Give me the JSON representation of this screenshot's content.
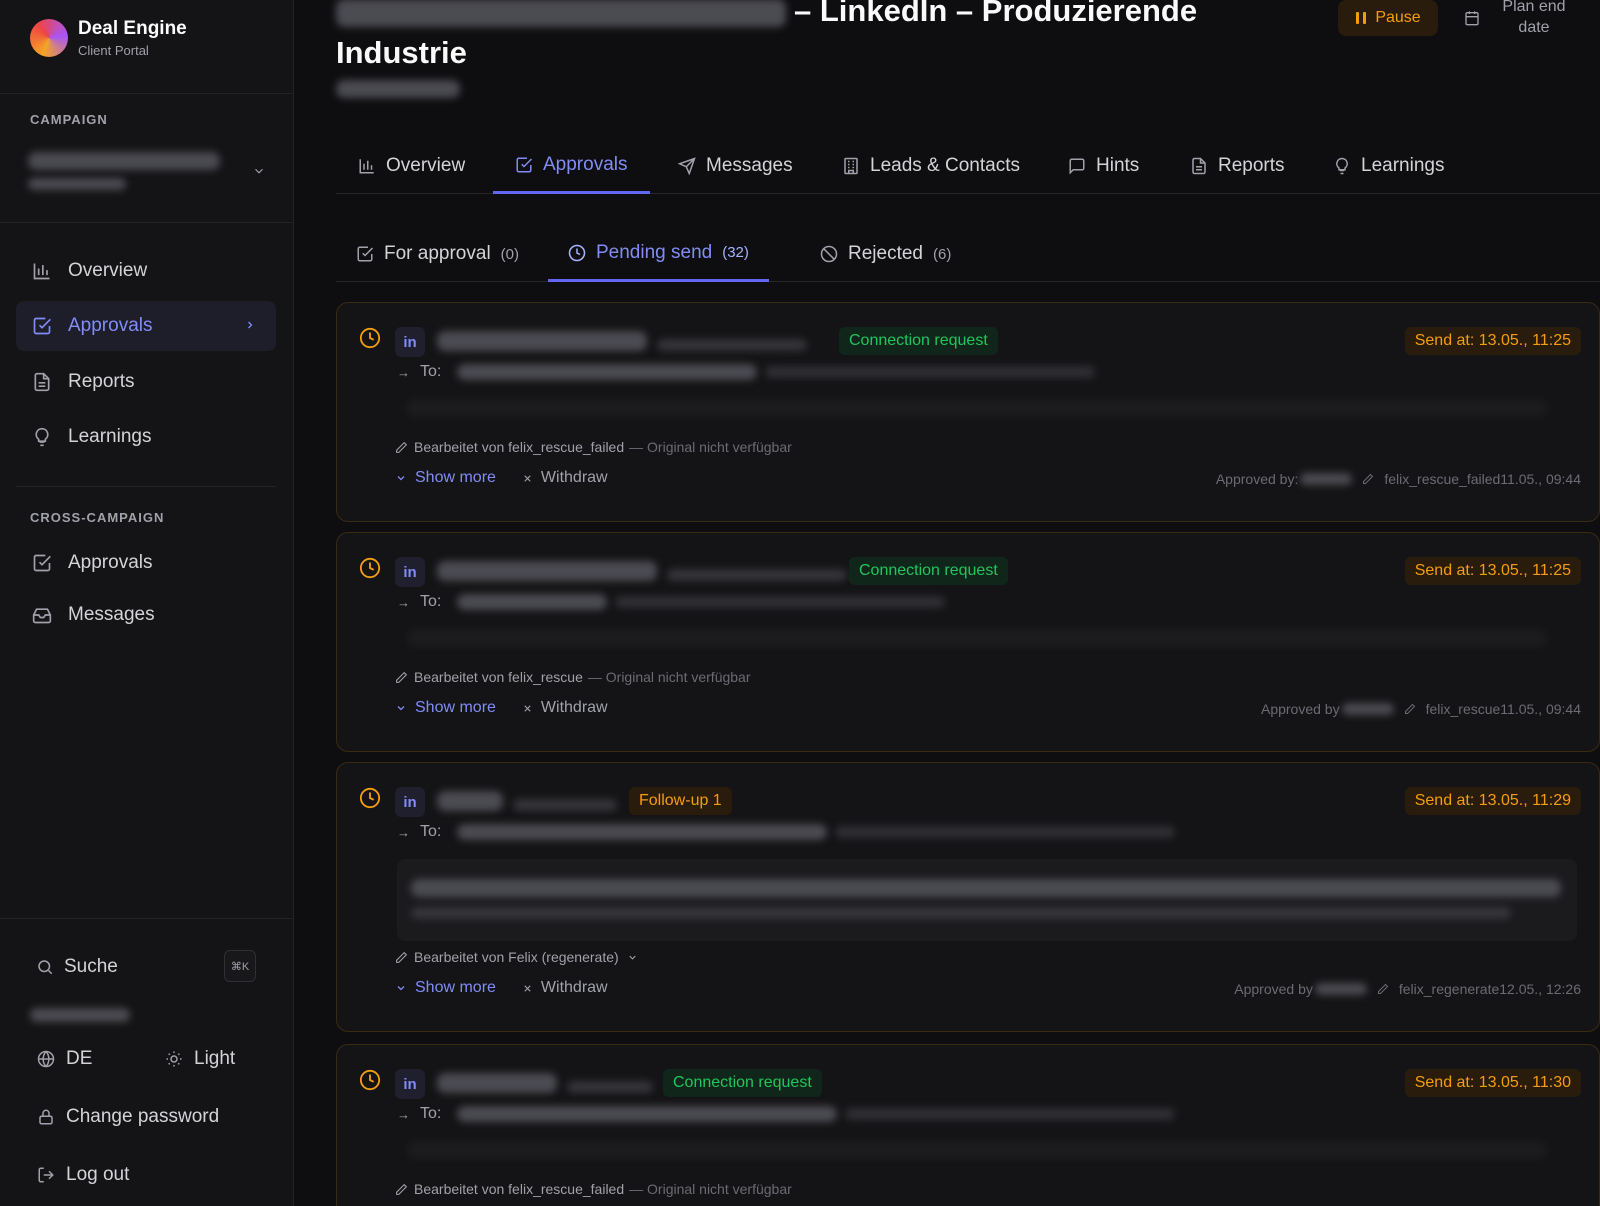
{
  "sidebar": {
    "brand_name": "Deal Engine",
    "brand_sub": "Client Portal",
    "campaign_label": "CAMPAIGN",
    "nav": [
      {
        "label": "Overview",
        "icon": "bar-chart-icon"
      },
      {
        "label": "Approvals",
        "icon": "check-square-icon",
        "active": true
      },
      {
        "label": "Reports",
        "icon": "file-text-icon"
      },
      {
        "label": "Learnings",
        "icon": "lightbulb-icon"
      }
    ],
    "cross_label": "CROSS-CAMPAIGN",
    "cross_nav": [
      {
        "label": "Approvals",
        "icon": "check-square-icon"
      },
      {
        "label": "Messages",
        "icon": "inbox-icon"
      }
    ],
    "search_label": "Suche",
    "search_kbd": "⌘K",
    "lang": "DE",
    "theme": "Light",
    "change_password": "Change password",
    "logout": "Log out"
  },
  "header": {
    "title_rest": "– LinkedIn – Produzierende Industrie",
    "pause": "Pause",
    "plan_end": "Plan end date"
  },
  "tabs": [
    {
      "label": "Overview"
    },
    {
      "label": "Approvals",
      "active": true
    },
    {
      "label": "Messages"
    },
    {
      "label": "Leads & Contacts"
    },
    {
      "label": "Hints"
    },
    {
      "label": "Reports"
    },
    {
      "label": "Learnings"
    }
  ],
  "subtabs": [
    {
      "label": "For approval",
      "count": "(0)"
    },
    {
      "label": "Pending send",
      "count": "(32)",
      "active": true
    },
    {
      "label": "Rejected",
      "count": "(6)"
    }
  ],
  "cards": [
    {
      "badge": "Connection request",
      "send_at": "Send at: 13.05., 11:25",
      "to": "To:",
      "edited_by": "Bearbeitet von felix_rescue_failed",
      "edited_note": "— Original nicht verfügbar",
      "show_more": "Show more",
      "withdraw": "Withdraw",
      "approved_label": "Approved by:",
      "approved_by": "felix_rescue_failed11.05., 09:44"
    },
    {
      "badge": "Connection request",
      "send_at": "Send at: 13.05., 11:25",
      "to": "To:",
      "edited_by": "Bearbeitet von felix_rescue",
      "edited_note": "— Original nicht verfügbar",
      "show_more": "Show more",
      "withdraw": "Withdraw",
      "approved_label": "Approved by",
      "approved_by": "felix_rescue11.05., 09:44"
    },
    {
      "badge": "Follow-up 1",
      "send_at": "Send at: 13.05., 11:29",
      "to": "To:",
      "edited_by": "Bearbeitet von Felix (regenerate)",
      "edited_note": "",
      "show_more": "Show more",
      "withdraw": "Withdraw",
      "approved_label": "Approved by",
      "approved_by": "felix_regenerate12.05., 12:26"
    },
    {
      "badge": "Connection request",
      "send_at": "Send at: 13.05., 11:30",
      "to": "To:",
      "edited_by": "Bearbeitet von felix_rescue_failed",
      "edited_note": "— Original nicht verfügbar"
    }
  ],
  "colors": {
    "accent": "#818cf8",
    "warning": "#f59e0b",
    "success": "#22c55e",
    "background": "#0e0e10"
  }
}
